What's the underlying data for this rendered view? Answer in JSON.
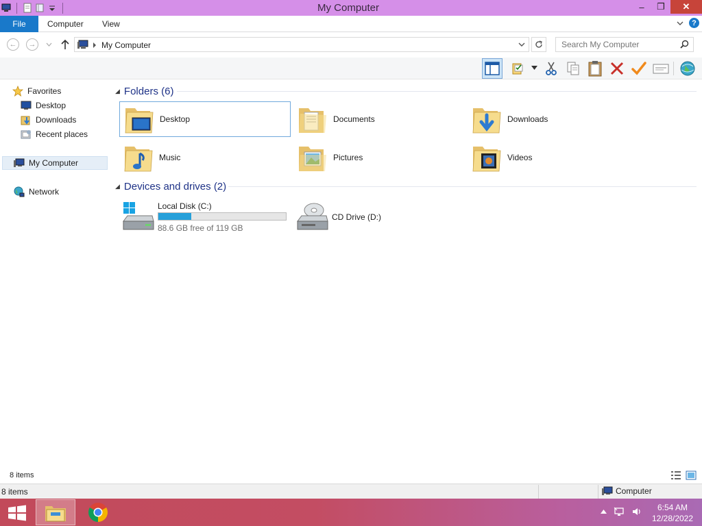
{
  "window": {
    "title": "My Computer",
    "minimize_glyph": "–",
    "restore_glyph": "❐",
    "close_glyph": "✕"
  },
  "ribbon": {
    "tabs": [
      "File",
      "Computer",
      "View"
    ]
  },
  "address": {
    "path": "My Computer",
    "search_placeholder": "Search My Computer"
  },
  "nav_pane": {
    "favorites": "Favorites",
    "favorites_items": [
      "Desktop",
      "Downloads",
      "Recent places"
    ],
    "computer": "My Computer",
    "network": "Network"
  },
  "content": {
    "folders_header": "Folders (6)",
    "folders": [
      {
        "label": "Desktop",
        "icon": "desktop-folder-icon"
      },
      {
        "label": "Documents",
        "icon": "documents-folder-icon"
      },
      {
        "label": "Downloads",
        "icon": "downloads-folder-icon"
      },
      {
        "label": "Music",
        "icon": "music-folder-icon"
      },
      {
        "label": "Pictures",
        "icon": "pictures-folder-icon"
      },
      {
        "label": "Videos",
        "icon": "videos-folder-icon"
      }
    ],
    "devices_header": "Devices and drives (2)",
    "drives": [
      {
        "name": "Local Disk (C:)",
        "free": "88.6 GB free of 119 GB",
        "used_fraction": 0.26
      },
      {
        "name": "CD Drive (D:)"
      }
    ]
  },
  "status": {
    "item_count": "8 items",
    "bottom_count": "8 items",
    "computer_label": "Computer"
  },
  "taskbar": {
    "time": "6:54 AM",
    "date": "12/28/2022"
  },
  "colors": {
    "titlebar": "#d58fe8",
    "file_tab": "#1979ca",
    "accent_blue": "#26a0da",
    "close_red": "#c7443a"
  }
}
